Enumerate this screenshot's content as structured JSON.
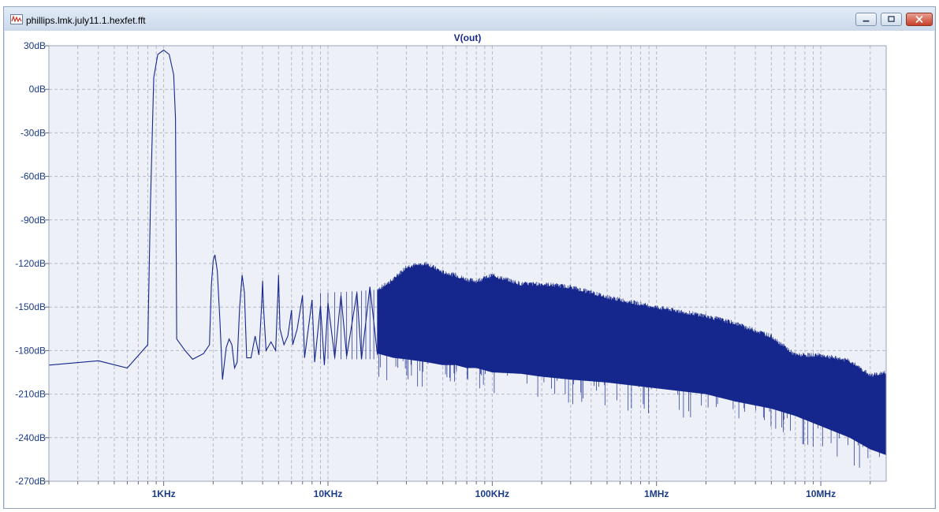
{
  "window": {
    "title": "phillips.lmk.july11.1.hexfet.fft",
    "minimize_label": "minimize",
    "maximize_label": "maximize",
    "close_label": "close"
  },
  "chart_data": {
    "type": "line",
    "title": "V(out)",
    "xlabel": "",
    "ylabel": "",
    "x_scale": "log",
    "xlim": [
      200,
      25000000
    ],
    "ylim": [
      -270,
      30
    ],
    "x_ticks": [
      {
        "value": 1000,
        "label": "1KHz"
      },
      {
        "value": 10000,
        "label": "10KHz"
      },
      {
        "value": 100000,
        "label": "100KHz"
      },
      {
        "value": 1000000,
        "label": "1MHz"
      },
      {
        "value": 10000000,
        "label": "10MHz"
      }
    ],
    "y_ticks": [
      {
        "value": 30,
        "label": "30dB"
      },
      {
        "value": 0,
        "label": "0dB"
      },
      {
        "value": -30,
        "label": "-30dB"
      },
      {
        "value": -60,
        "label": "-60dB"
      },
      {
        "value": -90,
        "label": "-90dB"
      },
      {
        "value": -120,
        "label": "-120dB"
      },
      {
        "value": -150,
        "label": "-150dB"
      },
      {
        "value": -180,
        "label": "-180dB"
      },
      {
        "value": -210,
        "label": "-210dB"
      },
      {
        "value": -240,
        "label": "-240dB"
      },
      {
        "value": -270,
        "label": "-270dB"
      }
    ],
    "grid": true,
    "colors": {
      "trace": "#15268c",
      "axis_text": "#1a3a8a",
      "plot_bg": "#eef0f8",
      "grid": "#b4b8c8"
    },
    "series": [
      {
        "points": [
          [
            200,
            -190
          ],
          [
            400,
            -187
          ],
          [
            600,
            -192
          ],
          [
            800,
            -176
          ],
          [
            830,
            -80
          ],
          [
            870,
            8
          ],
          [
            920,
            24
          ],
          [
            1000,
            27
          ],
          [
            1080,
            24
          ],
          [
            1150,
            10
          ],
          [
            1180,
            -20
          ],
          [
            1200,
            -172
          ],
          [
            1350,
            -180
          ],
          [
            1500,
            -186
          ],
          [
            1750,
            -182
          ],
          [
            1900,
            -176
          ],
          [
            1950,
            -135
          ],
          [
            2000,
            -118
          ],
          [
            2050,
            -114
          ],
          [
            2120,
            -125
          ],
          [
            2200,
            -160
          ],
          [
            2280,
            -200
          ],
          [
            2400,
            -178
          ],
          [
            2500,
            -172
          ],
          [
            2600,
            -176
          ],
          [
            2700,
            -192
          ],
          [
            2800,
            -188
          ],
          [
            2900,
            -150
          ],
          [
            3000,
            -128
          ],
          [
            3100,
            -140
          ],
          [
            3200,
            -185
          ],
          [
            3400,
            -185
          ],
          [
            3600,
            -170
          ],
          [
            3800,
            -183
          ],
          [
            3950,
            -148
          ],
          [
            4000,
            -132
          ],
          [
            4050,
            -150
          ],
          [
            4200,
            -180
          ],
          [
            4500,
            -174
          ],
          [
            4800,
            -180
          ],
          [
            4950,
            -142
          ],
          [
            5000,
            -128
          ],
          [
            5100,
            -165
          ],
          [
            5400,
            -176
          ],
          [
            5700,
            -170
          ],
          [
            6000,
            -152
          ],
          [
            6100,
            -176
          ],
          [
            6500,
            -165
          ],
          [
            7000,
            -142
          ],
          [
            7200,
            -185
          ],
          [
            8000,
            -145
          ],
          [
            8300,
            -188
          ],
          [
            9000,
            -149
          ],
          [
            9500,
            -190
          ],
          [
            10000,
            -147
          ],
          [
            11000,
            -185
          ],
          [
            12000,
            -142
          ],
          [
            13000,
            -184
          ],
          [
            15000,
            -140
          ],
          [
            16000,
            -186
          ],
          [
            18000,
            -136
          ],
          [
            20000,
            -183
          ]
        ]
      }
    ],
    "dense_band": [
      [
        20000,
        -138,
        -182
      ],
      [
        25000,
        -131,
        -185
      ],
      [
        30000,
        -122,
        -186
      ],
      [
        40000,
        -120,
        -188
      ],
      [
        50000,
        -126,
        -190
      ],
      [
        60000,
        -128,
        -190
      ],
      [
        70000,
        -131,
        -192
      ],
      [
        80000,
        -132,
        -192
      ],
      [
        100000,
        -128,
        -195
      ],
      [
        150000,
        -134,
        -196
      ],
      [
        200000,
        -134,
        -198
      ],
      [
        300000,
        -136,
        -200
      ],
      [
        500000,
        -143,
        -202
      ],
      [
        1000000,
        -150,
        -206
      ],
      [
        2000000,
        -156,
        -210
      ],
      [
        3000000,
        -161,
        -215
      ],
      [
        5000000,
        -170,
        -220
      ],
      [
        7000000,
        -183,
        -225
      ],
      [
        10000000,
        -183,
        -232
      ],
      [
        15000000,
        -187,
        -240
      ],
      [
        20000000,
        -197,
        -248
      ],
      [
        25000000,
        -195,
        -252
      ]
    ],
    "lobes": [
      [
        70000,
        -136
      ],
      [
        95000,
        -132
      ],
      [
        130000,
        -138
      ],
      [
        165000,
        -139
      ],
      [
        210000,
        -141
      ],
      [
        260000,
        -141
      ],
      [
        330000,
        -143
      ]
    ]
  }
}
